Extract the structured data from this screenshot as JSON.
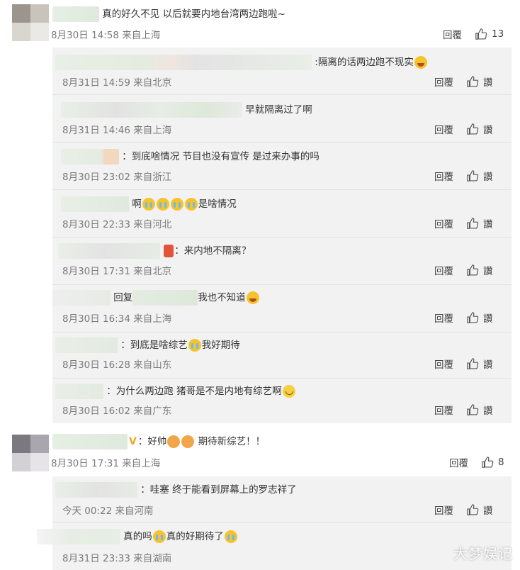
{
  "comment1": {
    "text": "真的好久不见 以后就要内地台湾两边跑啦~",
    "meta": "8月30日 14:58 来自上海",
    "reply_label": "回覆",
    "like_count": "13",
    "replies": [
      {
        "text": ":隔离的话两边跑不现实",
        "meta": "8月31日 14:59 来自北京",
        "reply_label": "回覆",
        "like_label": "讚"
      },
      {
        "text": "早就隔离过了啊",
        "meta": "8月31日 14:46 来自上海",
        "reply_label": "回覆",
        "like_label": "讚"
      },
      {
        "text": "：到底啥情况 节目也没有宣传 是过来办事的吗",
        "meta": "8月30日 23:02 来自浙江",
        "reply_label": "回覆",
        "like_label": "讚"
      },
      {
        "text_a": "啊",
        "text_b": "是啥情况",
        "meta": "8月30日 22:33 来自河北",
        "reply_label": "回覆",
        "like_label": "讚"
      },
      {
        "text": "：来内地不隔离？",
        "meta": "8月30日 17:31 来自北京",
        "reply_label": "回覆",
        "like_label": "讚"
      },
      {
        "text_a": "回复",
        "text_b": "我也不知道",
        "meta": "8月30日 16:34 来自上海",
        "reply_label": "回覆",
        "like_label": "讚"
      },
      {
        "text_a": "：到底是啥综艺",
        "text_b": "我好期待",
        "meta": "8月30日 16:28 来自山东",
        "reply_label": "回覆",
        "like_label": "讚"
      },
      {
        "text": "：为什么两边跑 猪哥是不是内地有综艺啊",
        "meta": "8月30日 16:02 来自广东",
        "reply_label": "回覆",
        "like_label": "讚"
      }
    ]
  },
  "comment2": {
    "text_a": "：好帅",
    "text_b": "期待新综艺！！",
    "meta": "8月30日 17:31 来自上海",
    "reply_label": "回覆",
    "like_count": "8",
    "replies": [
      {
        "text": "：哇塞 终于能看到屏幕上的罗志祥了",
        "meta": "今天 00:22 来自河南",
        "reply_label": "回覆",
        "like_label": "讚"
      },
      {
        "text_a": "真的吗",
        "text_b": "真的好期待了",
        "meta": "8月31日 23:33 来自湖南",
        "reply_label": "回覆",
        "like_label": "讚"
      }
    ]
  },
  "watermark": "大梦娱记",
  "icons": {
    "like": "thumbs-up-icon",
    "verified": "verified-v-icon"
  }
}
